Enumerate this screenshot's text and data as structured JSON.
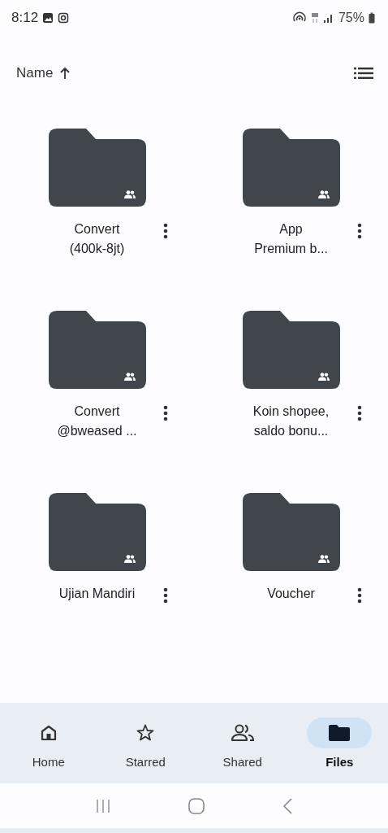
{
  "status_bar": {
    "time": "8:12",
    "battery": "75%"
  },
  "sort": {
    "label": "Name"
  },
  "folders": [
    {
      "name_lines": [
        "Convert",
        "(400k-8jt)"
      ],
      "shared": true
    },
    {
      "name_lines": [
        "App",
        "Premium b..."
      ],
      "shared": true
    },
    {
      "name_lines": [
        "Convert",
        "@bweased ..."
      ],
      "shared": true
    },
    {
      "name_lines": [
        "Koin shopee,",
        "saldo bonu..."
      ],
      "shared": true
    },
    {
      "name_lines": [
        "Ujian Mandiri"
      ],
      "shared": true
    },
    {
      "name_lines": [
        "Voucher"
      ],
      "shared": true
    }
  ],
  "bottom_nav": [
    {
      "label": "Home",
      "kind": "home",
      "selected": false
    },
    {
      "label": "Starred",
      "kind": "star",
      "selected": false
    },
    {
      "label": "Shared",
      "kind": "people",
      "selected": false
    },
    {
      "label": "Files",
      "kind": "folder",
      "selected": true
    }
  ]
}
